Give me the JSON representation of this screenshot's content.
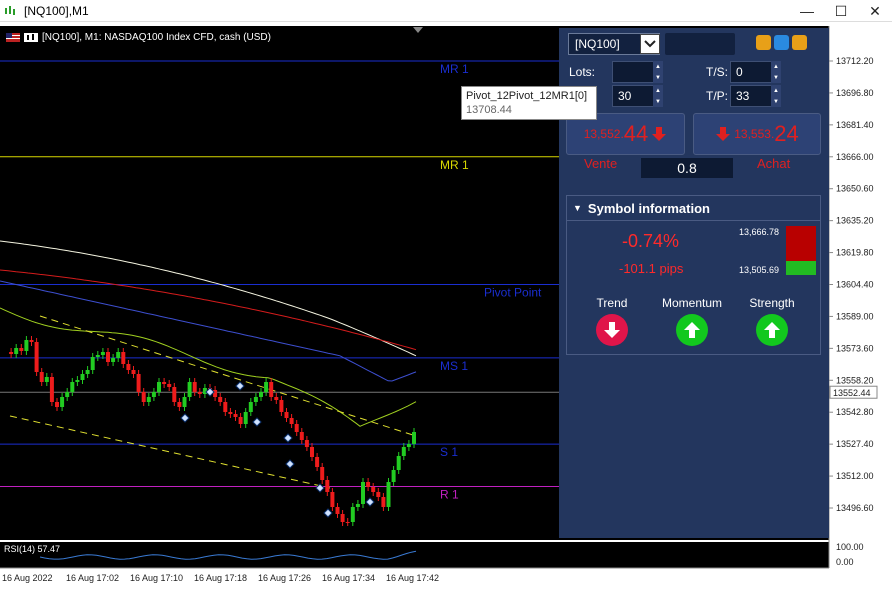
{
  "window": {
    "title": "[NQ100],M1",
    "controls": {
      "minimize": "—",
      "maximize": "☐",
      "close": "✕"
    }
  },
  "chart": {
    "header": "[NQ100], M1:  NASDAQ100 Index CFD, cash (USD)",
    "price_axis": [
      "13712.20",
      "13696.80",
      "13681.40",
      "13666.00",
      "13650.60",
      "13635.20",
      "13619.80",
      "13604.40",
      "13589.00",
      "13573.60",
      "13558.20",
      "13542.80",
      "13527.40",
      "13512.00",
      "13496.60"
    ],
    "current_price": "13552.44",
    "time_axis": [
      "16 Aug 2022",
      "16 Aug 17:02",
      "16 Aug 17:10",
      "16 Aug 17:18",
      "16 Aug 17:26",
      "16 Aug 17:34",
      "16 Aug 17:42"
    ],
    "levels": [
      {
        "label": "MR 1",
        "color": "#1a2ed0",
        "price": 13712.2
      },
      {
        "label": "MR 1",
        "color": "#d8d800",
        "price": 13666.0
      },
      {
        "label": "Pivot Point",
        "color": "#1a2ed0",
        "price": 13604.4
      },
      {
        "label": "MS 1",
        "color": "#1a2ed0",
        "price": 13569.0
      },
      {
        "label": "S 1",
        "color": "#1a2ed0",
        "price": 13527.4
      },
      {
        "label": "R 1",
        "color": "#c020c0",
        "price": 13507.0
      }
    ],
    "tooltip": {
      "name": "Pivot_12Pivot_12MR1[0]",
      "value": "13708.44"
    },
    "rsi": {
      "label": "RSI(14) 57.47",
      "max": "100.00",
      "min": "0.00"
    }
  },
  "panel": {
    "symbol": "[NQ100]",
    "lots_label": "Lots:",
    "lots_value": "",
    "second_value": "30",
    "ts_label": "T/S:",
    "ts_value": "0",
    "tp_label": "T/P:",
    "tp_value": "33",
    "sell": {
      "small": "13,552.",
      "big": "44",
      "label": "Vente"
    },
    "buy": {
      "small": "13,553.",
      "big": "24",
      "label": "Achat"
    },
    "spread": "0.8",
    "symbol_info": {
      "title": "Symbol information",
      "change_pct": "-0.74%",
      "change_pips": "-101.1 pips",
      "high": "13,666.78",
      "low": "13,505.69",
      "trend_label": "Trend",
      "momentum_label": "Momentum",
      "strength_label": "Strength",
      "trend": "down",
      "momentum": "up",
      "strength": "up"
    }
  },
  "colors": {
    "up_candle": "#22cc22",
    "down_candle": "#ee1c1c",
    "panel_bg": "#23365e",
    "chart_bg": "#000000"
  }
}
